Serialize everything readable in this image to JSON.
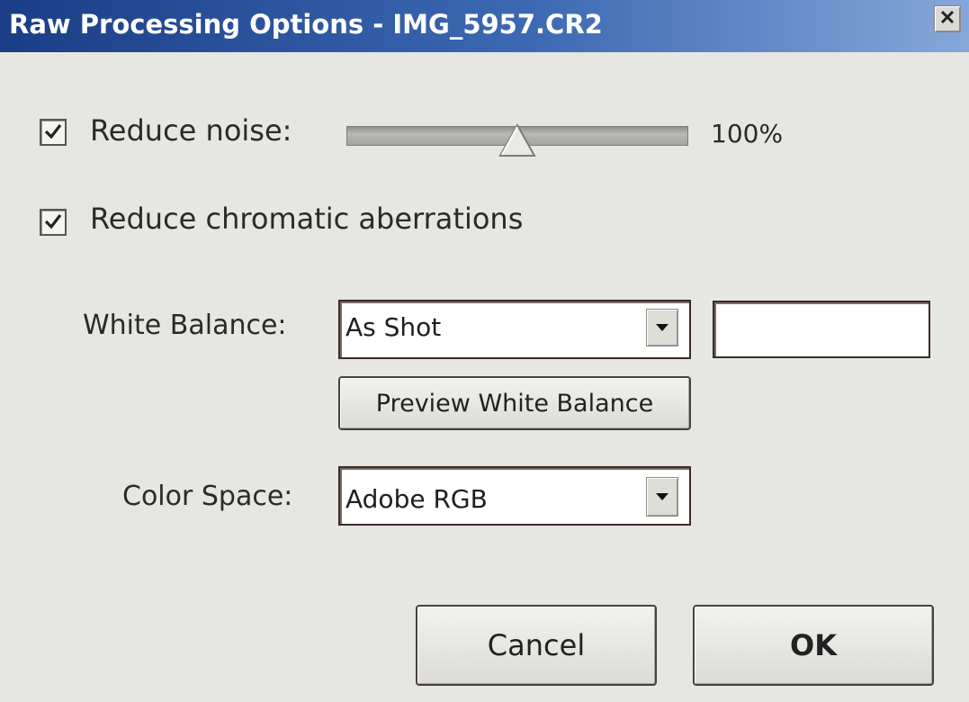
{
  "window": {
    "title": "Raw Processing Options - IMG_5957.CR2",
    "close_symbol": "✕"
  },
  "noise": {
    "label": "Reduce noise:",
    "checked": true,
    "value_text": "100%",
    "slider_fraction": 0.5
  },
  "chromatic": {
    "label": "Reduce chromatic aberrations",
    "checked": true
  },
  "white_balance": {
    "label": "White Balance:",
    "selected": "As Shot",
    "extra_value": "",
    "preview_button": "Preview White Balance"
  },
  "color_space": {
    "label": "Color Space:",
    "selected": "Adobe RGB"
  },
  "buttons": {
    "cancel": "Cancel",
    "ok": "OK"
  },
  "icons": {
    "checkbox": "checkmark-icon",
    "dropdown": "chevron-down-icon",
    "close": "close-icon",
    "slider": "slider-thumb-icon"
  }
}
